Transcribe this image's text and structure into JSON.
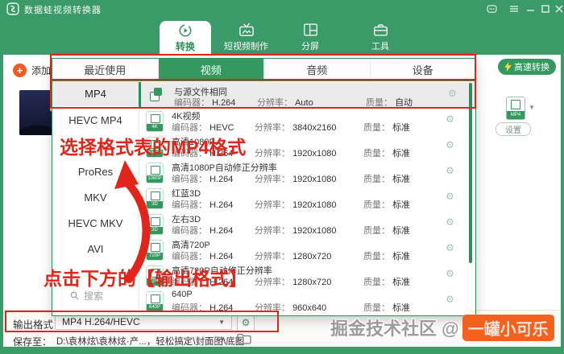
{
  "window": {
    "title": "数据蛙视频转换器"
  },
  "nav": {
    "tabs": [
      {
        "label": "转换"
      },
      {
        "label": "短视频制作"
      },
      {
        "label": "分屏"
      },
      {
        "label": "工具"
      }
    ]
  },
  "toolbar": {
    "add_file": "添加文",
    "fast_convert": "高速转换",
    "settings": "设置",
    "format_chip": "MP4"
  },
  "format_panel": {
    "tabs": [
      {
        "label": "最近使用"
      },
      {
        "label": "视频"
      },
      {
        "label": "音频"
      },
      {
        "label": "设备"
      }
    ],
    "active_tab": "视频",
    "categories": [
      {
        "label": "MP4"
      },
      {
        "label": "HEVC MP4"
      },
      {
        "label": ""
      },
      {
        "label": "ProRes"
      },
      {
        "label": "MKV"
      },
      {
        "label": "HEVC MKV"
      },
      {
        "label": "AVI"
      },
      {
        "label": ""
      }
    ],
    "search": "搜索",
    "labels": {
      "encoder": "编码器：",
      "resolution": "分辨率：",
      "quality": "质量："
    },
    "rows": [
      {
        "title": "与源文件相同",
        "badge": "copy",
        "encoder": "H.264",
        "resolution": "Auto",
        "quality": "自动"
      },
      {
        "title": "4K视频",
        "badge": "4K",
        "encoder": "HEVC",
        "resolution": "3840x2160",
        "quality": "标准"
      },
      {
        "title": "高清1080P",
        "badge": "1080P",
        "encoder": "H.264",
        "resolution": "1920x1080",
        "quality": "标准"
      },
      {
        "title": "高清1080P自动修正分辨率",
        "badge": "1080P",
        "encoder": "H.264",
        "resolution": "1920x1080",
        "quality": "标准"
      },
      {
        "title": "红蓝3D",
        "badge": "3D",
        "encoder": "H.264",
        "resolution": "1920x1080",
        "quality": "标准"
      },
      {
        "title": "左右3D",
        "badge": "3D",
        "encoder": "H.264",
        "resolution": "1920x1080",
        "quality": "标准"
      },
      {
        "title": "高清720P",
        "badge": "720P",
        "encoder": "H.264",
        "resolution": "1280x720",
        "quality": "标准"
      },
      {
        "title": "高清720P自动修正分辨率",
        "badge": "720P",
        "encoder": "H.264",
        "resolution": "1280x720",
        "quality": "标准"
      },
      {
        "title": "640P",
        "badge": "640P",
        "encoder": "H.264",
        "resolution": "960x640",
        "quality": "标准"
      }
    ]
  },
  "footer": {
    "output_label": "输出格式：",
    "output_value": "MP4 H.264/HEVC",
    "save_label": "保存至：",
    "save_path": "D:\\袁林炫\\袁林炫·产...，轻松搞定\\封面图\\底图"
  },
  "watermark": {
    "prefix": "掘金技术社区 @",
    "highlight": "一罐小可乐"
  },
  "annotations": {
    "select_format": "选择格式表的MP4格式",
    "click_output": "点击下方的【输出格式】"
  },
  "colors": {
    "brand_green": "#35985f",
    "annotation_red": "#e1251b",
    "accent_orange": "#f4611f"
  }
}
